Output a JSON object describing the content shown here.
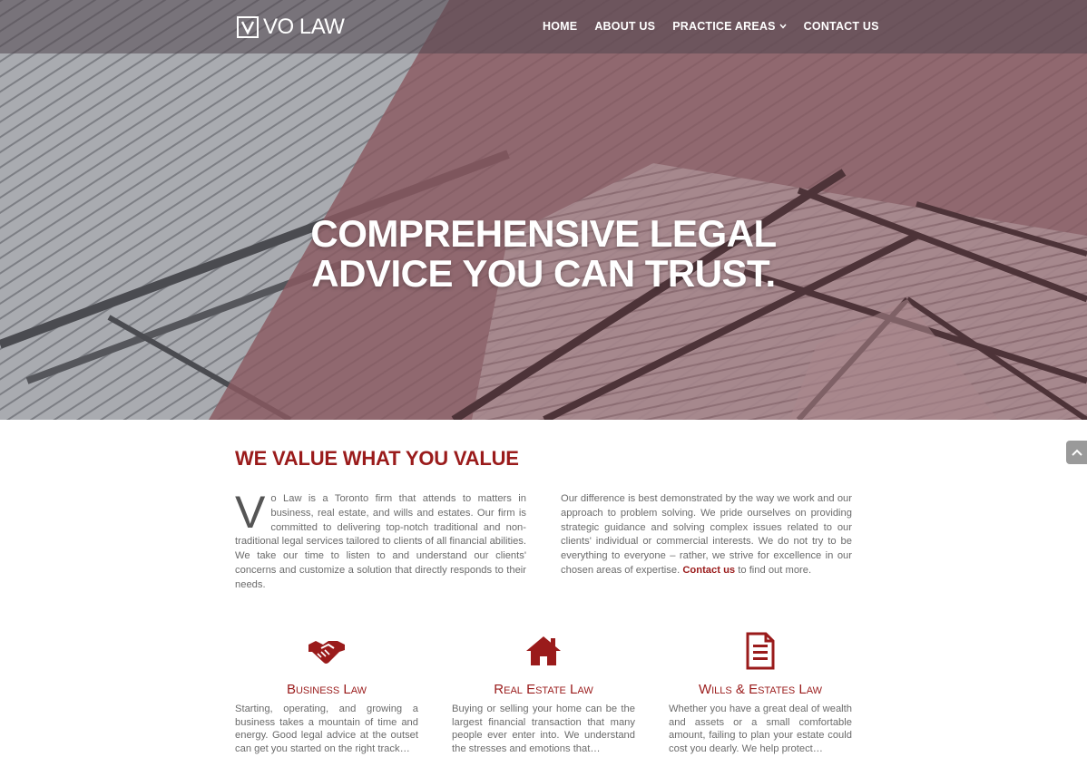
{
  "brand": {
    "logo_letter": "V",
    "name": "VO LAW"
  },
  "nav": {
    "items": [
      {
        "label": "HOME"
      },
      {
        "label": "ABOUT US"
      },
      {
        "label": "PRACTICE AREAS",
        "caret": "⌄"
      },
      {
        "label": "CONTACT US"
      }
    ]
  },
  "hero": {
    "title_line1": "COMPREHENSIVE LEGAL",
    "title_line2": "ADVICE YOU CAN TRUST."
  },
  "intro": {
    "heading": "WE VALUE WHAT YOU VALUE",
    "left_dropcap": "V",
    "left_text": "o Law is a Toronto firm that attends to matters in business, real estate, and wills and estates. Our firm is committed to delivering top-notch traditional and non-traditional legal services tailored to clients of all financial abilities. We take our time to listen to and understand our clients' concerns and customize a solution that directly responds to their needs.",
    "right_text": "Our difference is best demonstrated by the way we work and our approach to problem solving. We pride ourselves on providing strategic guidance and solving complex issues related to our clients' individual or commercial interests. We do not try to be everything to everyone – rather, we strive for excellence in our chosen areas of expertise.",
    "right_link": "Contact us",
    "right_tail": "to find out more."
  },
  "practice_areas": [
    {
      "icon": "handshake-icon",
      "title": "Business Law",
      "text": "Starting, operating, and growing a business takes a mountain of time and energy. Good legal advice at the outset can get you started on the right track…"
    },
    {
      "icon": "house-icon",
      "title": "Real Estate Law",
      "text": "Buying or selling your home can be the largest financial transaction that many people ever enter into. We understand the stresses and emotions that…"
    },
    {
      "icon": "document-icon",
      "title": "Wills & Estates Law",
      "text": "Whether you have a great deal of wealth and assets or a small comfortable amount, failing to plan your estate could cost you dearly. We help protect…"
    }
  ],
  "colors": {
    "accent": "#9a1b1b",
    "hero_overlay": "#8a5c63",
    "body_text": "#6b6b6b"
  }
}
